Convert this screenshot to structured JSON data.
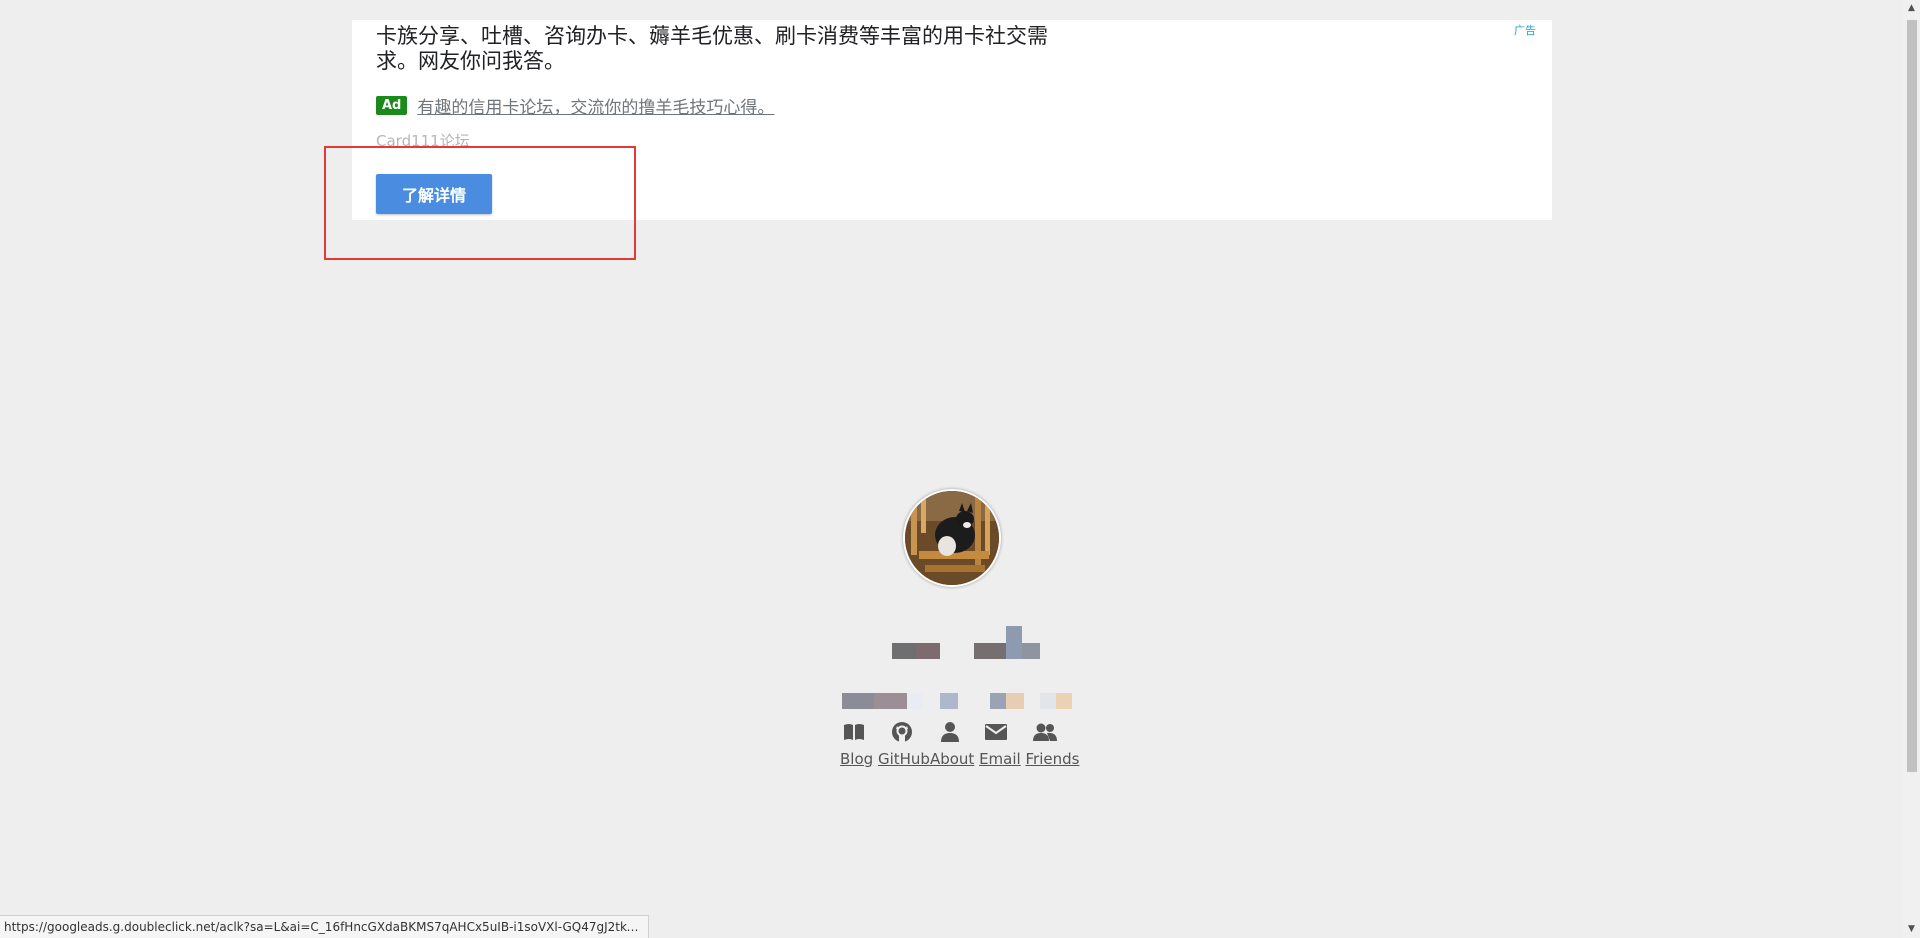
{
  "ad": {
    "corner_label": "广告",
    "description": "卡族分享、吐槽、咨询办卡、薅羊毛优惠、刷卡消费等丰富的用卡社交需求。网友你问我答。",
    "badge": "Ad",
    "headline": "有趣的信用卡论坛，交流你的撸羊毛技巧心得。",
    "source": "Card111论坛",
    "cta_label": "了解详情"
  },
  "profile": {
    "avatar_icon": "avatar-cat-photo"
  },
  "nav": {
    "icons": [
      "book-icon",
      "github-icon",
      "user-icon",
      "envelope-icon",
      "users-icon"
    ],
    "blog": "Blog",
    "github": "GitHub",
    "about": "About",
    "email": "Email",
    "friends": "Friends"
  },
  "status_bar": {
    "url": "https://googleads.g.doubleclick.net/aclk?sa=L&ai=C_16fHncGXdaBKMS7qAHCx5uIB-i1soVXl-GQ47gJ2tkeEA..."
  },
  "colors": {
    "page_bg": "#eeeeee",
    "cta_bg": "#4a8de0",
    "badge_bg": "#1a8a1a",
    "highlight": "#e53935",
    "corner_label": "#1e9fd9"
  }
}
